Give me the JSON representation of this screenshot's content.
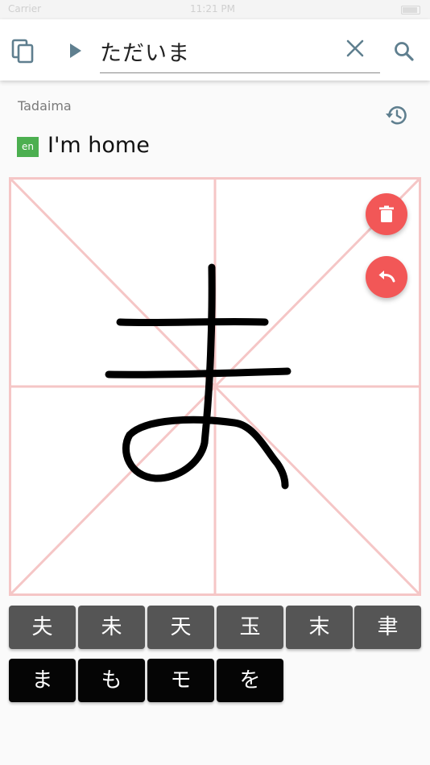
{
  "status_bar": {
    "carrier": "Carrier",
    "time": "11:21 PM"
  },
  "header": {
    "search_value": "ただいま"
  },
  "result": {
    "romaji": "Tadaima",
    "language_badge": "en",
    "translation": "I'm home"
  },
  "canvas": {
    "icons": {
      "delete": "trash-icon",
      "undo": "undo-icon"
    }
  },
  "candidates": {
    "row1": [
      "夫",
      "未",
      "天",
      "玉",
      "末",
      "聿"
    ],
    "row2": [
      "ま",
      "も",
      "モ",
      "を"
    ]
  },
  "colors": {
    "fab": "#f25757",
    "grid_lines": "#f5c6c6",
    "badge": "#4caf50",
    "key_row1": "#555555",
    "key_row2": "#050505"
  }
}
